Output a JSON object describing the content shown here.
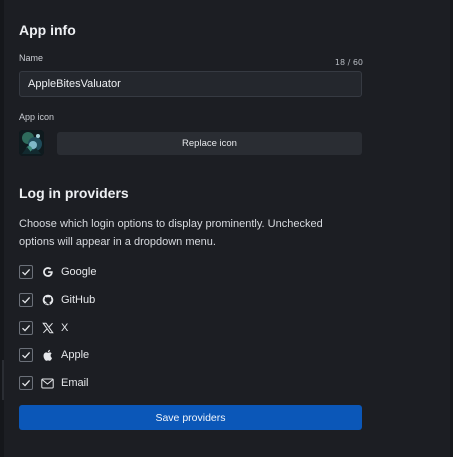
{
  "app_info": {
    "title": "App info",
    "name_label": "Name",
    "name_counter": "18 / 60",
    "name_value": "AppleBitesValuator",
    "icon_label": "App icon",
    "replace_icon_label": "Replace icon"
  },
  "login_providers": {
    "title": "Log in providers",
    "description": "Choose which login options to display prominently. Unchecked options will appear in a dropdown menu.",
    "providers": [
      {
        "label": "Google",
        "checked": true,
        "icon": "google-icon"
      },
      {
        "label": "GitHub",
        "checked": true,
        "icon": "github-icon"
      },
      {
        "label": "X",
        "checked": true,
        "icon": "x-icon"
      },
      {
        "label": "Apple",
        "checked": true,
        "icon": "apple-icon"
      },
      {
        "label": "Email",
        "checked": true,
        "icon": "email-icon"
      }
    ],
    "save_label": "Save providers"
  },
  "colors": {
    "background": "#1c1e23",
    "accent": "#0b57b8",
    "input_background": "#24272d"
  }
}
